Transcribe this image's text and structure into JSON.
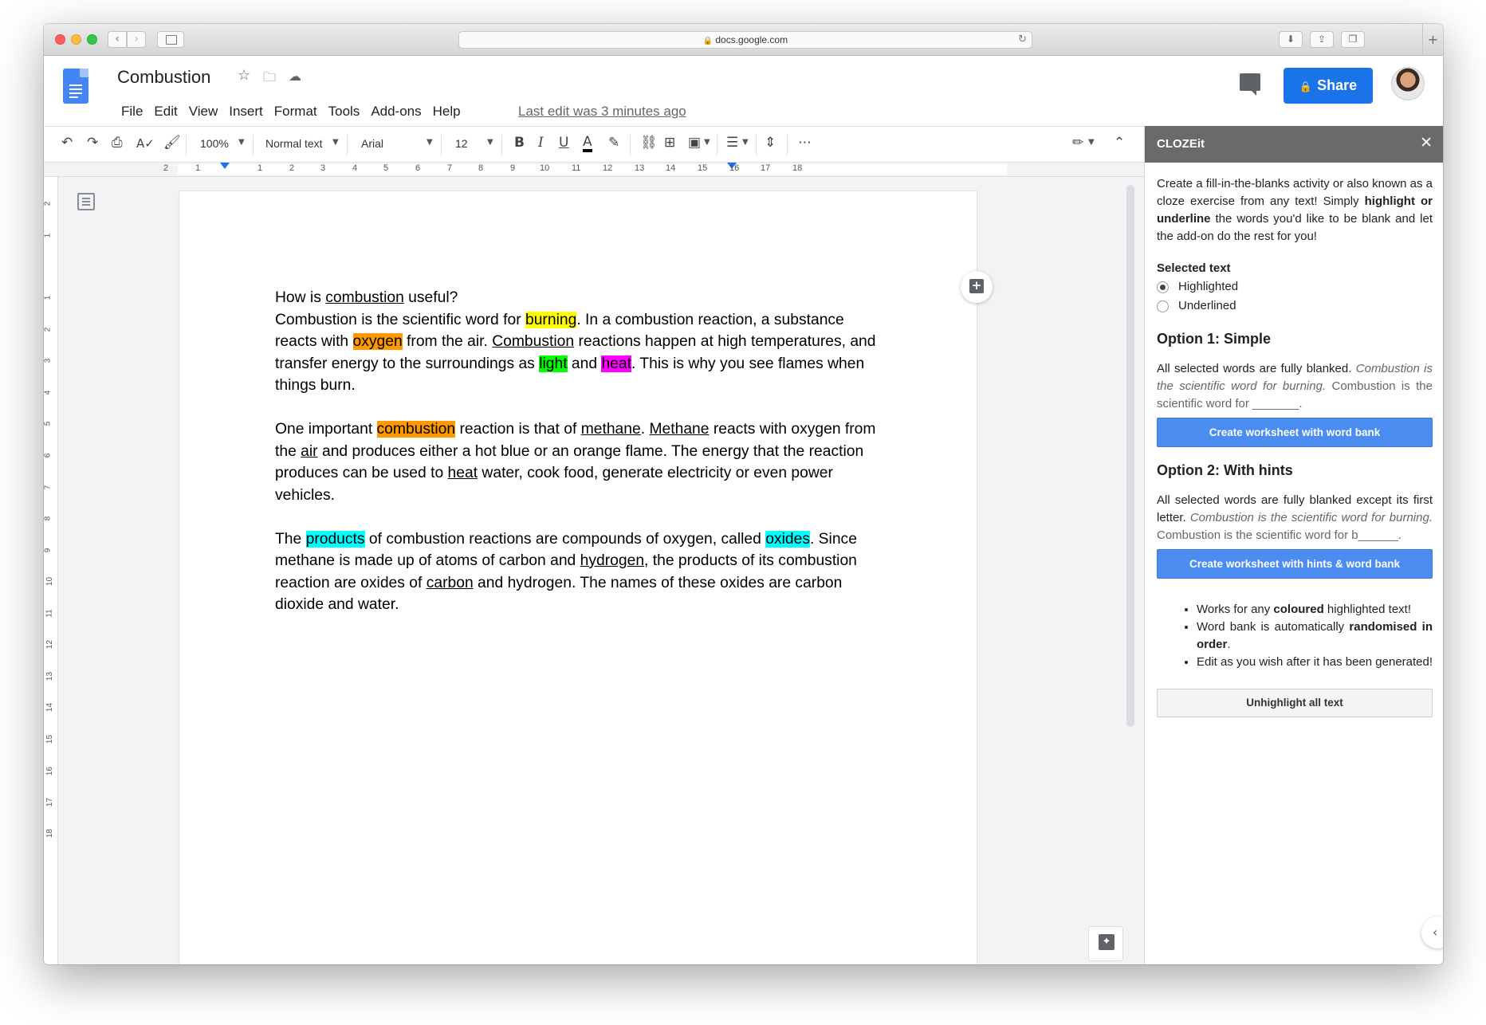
{
  "browser": {
    "url": "docs.google.com"
  },
  "header": {
    "doc_title": "Combustion",
    "menu": [
      "File",
      "Edit",
      "View",
      "Insert",
      "Format",
      "Tools",
      "Add-ons",
      "Help"
    ],
    "last_edit": "Last edit was 3 minutes ago",
    "share_label": "Share"
  },
  "toolbar": {
    "zoom": "100%",
    "style": "Normal text",
    "font": "Arial",
    "size": "12"
  },
  "ruler": {
    "h_ticks": [
      "2",
      "1",
      "1",
      "2",
      "3",
      "4",
      "5",
      "6",
      "7",
      "8",
      "9",
      "10",
      "11",
      "12",
      "13",
      "14",
      "15",
      "16",
      "17",
      "18"
    ],
    "v_ticks": [
      "2",
      "1",
      "1",
      "2",
      "3",
      "4",
      "5",
      "6",
      "7",
      "8",
      "9",
      "10",
      "11",
      "12",
      "13",
      "14",
      "15",
      "16",
      "17",
      "18"
    ]
  },
  "document": {
    "p1": {
      "t1": "How is ",
      "u1": "combustion",
      "t2": " useful?",
      "t3": "Combustion is the scientific word for ",
      "h1": "burning",
      "t4": ". In a combustion reaction, a substance reacts with ",
      "h2": "oxygen",
      "t5": " from the air. ",
      "u2": "Combustion",
      "t6": " reactions happen at high temperatures, and transfer energy to the surroundings as ",
      "h3": "light",
      "t7": " and ",
      "h4": "heat",
      "t8": ". This is why you see flames when things burn."
    },
    "p2": {
      "t1": "One important ",
      "h1": "combustion",
      "t2": " reaction is that of ",
      "u1": "methane",
      "t3": ". ",
      "u2": "Methane",
      "t4": " reacts with oxygen from the ",
      "u3": "air",
      "t5": " and produces either a hot blue or an orange flame. The energy that the reaction produces can be used to ",
      "u4": "heat",
      "t6": " water, cook food, generate electricity or even power vehicles."
    },
    "p3": {
      "t1": "The ",
      "h1": "products",
      "t2": " of combustion reactions are compounds of oxygen, called ",
      "h2": "oxides",
      "t3": ". Since methane is made up of atoms of carbon and ",
      "u1": "hydrogen",
      "t4": ", the products of its combustion reaction are oxides of ",
      "u2": "carbon",
      "t5": " and hydrogen. The names of these oxides are carbon dioxide and water."
    }
  },
  "panel": {
    "title": "CLOZEit",
    "intro_a": "Create a fill-in-the-blanks activity or also known as a cloze exercise from any text! Simply ",
    "intro_bold": "highlight or underline",
    "intro_b": " the words you'd like to be blank and let the add-on do the rest for you!",
    "selected_label": "Selected text",
    "radio_highlighted": "Highlighted",
    "radio_underlined": "Underlined",
    "opt1_title": "Option 1: Simple",
    "opt1_desc": "All selected words are fully blanked. ",
    "opt1_example_italic": "Combustion is the scientific word for burning.",
    "opt1_example_result": " Combustion is the scientific word for _______.",
    "opt1_button": "Create worksheet with word bank",
    "opt2_title": "Option 2: With hints",
    "opt2_desc": "All selected words are fully blanked except its first letter. ",
    "opt2_example_italic": "Combustion is the scientific word for burning.",
    "opt2_example_result": " Combustion is the scientific word for b______.",
    "opt2_button": "Create worksheet with hints & word bank",
    "bullet1_a": "Works for any ",
    "bullet1_b": "coloured",
    "bullet1_c": " highlighted text!",
    "bullet2_a": "Word bank is automatically ",
    "bullet2_b": "randomised in order",
    "bullet2_c": ".",
    "bullet3": "Edit as you wish after it has been generated!",
    "unhighlight_button": "Unhighlight all text"
  },
  "colors": {
    "share_blue": "#1a73e8",
    "panel_header": "#6a6a6a",
    "highlight_yellow": "#ffff00",
    "highlight_orange": "#ff9900",
    "highlight_green": "#00ff00",
    "highlight_magenta": "#ff00ff",
    "highlight_cyan": "#00ffff"
  },
  "icons": [
    "undo-icon",
    "redo-icon",
    "print-icon",
    "spellcheck-icon",
    "paint-format-icon",
    "bold-icon",
    "italic-icon",
    "underline-icon",
    "text-color-icon",
    "highlight-icon",
    "link-icon",
    "comment-icon",
    "image-icon",
    "align-icon",
    "line-spacing-icon",
    "more-icon",
    "edit-mode-icon",
    "collapse-icon",
    "star-icon",
    "folder-icon",
    "cloud-icon"
  ]
}
